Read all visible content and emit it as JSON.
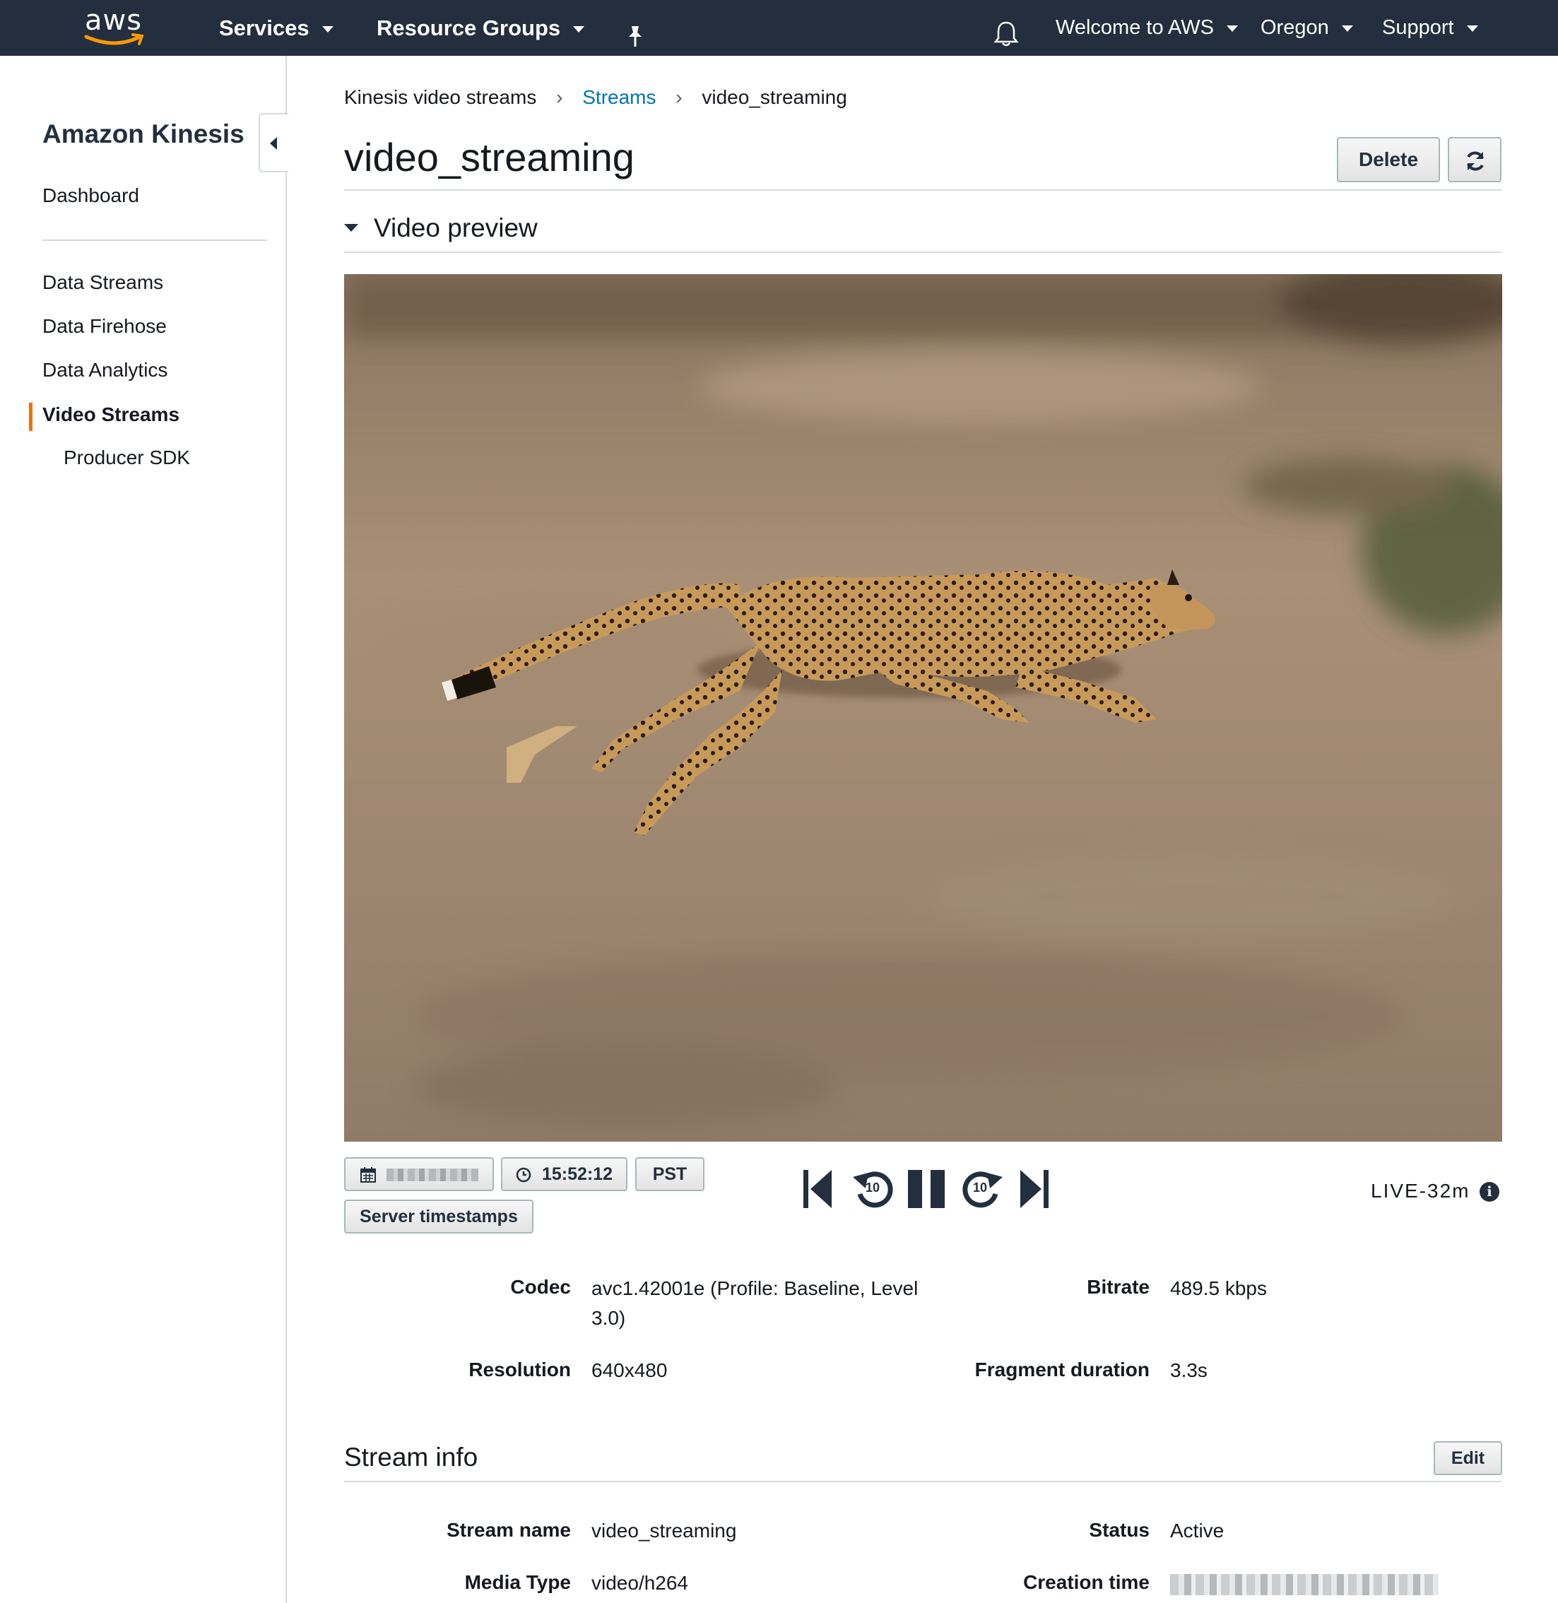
{
  "topnav": {
    "logo_text": "aws",
    "services": "Services",
    "resource_groups": "Resource Groups",
    "welcome": "Welcome to AWS",
    "region": "Oregon",
    "support": "Support",
    "colors": {
      "bar": "#232f3e",
      "logo_smile": "#ff9900"
    }
  },
  "sidebar": {
    "title": "Amazon Kinesis",
    "dashboard": "Dashboard",
    "items": [
      "Data Streams",
      "Data Firehose",
      "Data Analytics",
      "Video Streams"
    ],
    "active_item": "Video Streams",
    "sub_item": "Producer SDK",
    "accent": "#ec7211"
  },
  "breadcrumb": {
    "root": "Kinesis video streams",
    "streams": "Streams",
    "current": "video_streaming"
  },
  "page": {
    "title": "video_streaming",
    "delete_label": "Delete"
  },
  "video_preview": {
    "section_title": "Video preview",
    "time": "15:52:12",
    "timezone": "PST",
    "timestamps_button": "Server timestamps",
    "skip_seconds": "10",
    "live_label": "LIVE-32m",
    "info_glyph": "i"
  },
  "media_details": {
    "codec_label": "Codec",
    "codec_value": "avc1.42001e (Profile: Baseline, Level 3.0)",
    "bitrate_label": "Bitrate",
    "bitrate_value": "489.5 kbps",
    "resolution_label": "Resolution",
    "resolution_value": "640x480",
    "fragment_label": "Fragment duration",
    "fragment_value": "3.3s"
  },
  "stream_info": {
    "title": "Stream info",
    "edit_label": "Edit",
    "stream_name_label": "Stream name",
    "stream_name_value": "video_streaming",
    "status_label": "Status",
    "status_value": "Active",
    "media_type_label": "Media Type",
    "media_type_value": "video/h264",
    "creation_time_label": "Creation time"
  }
}
